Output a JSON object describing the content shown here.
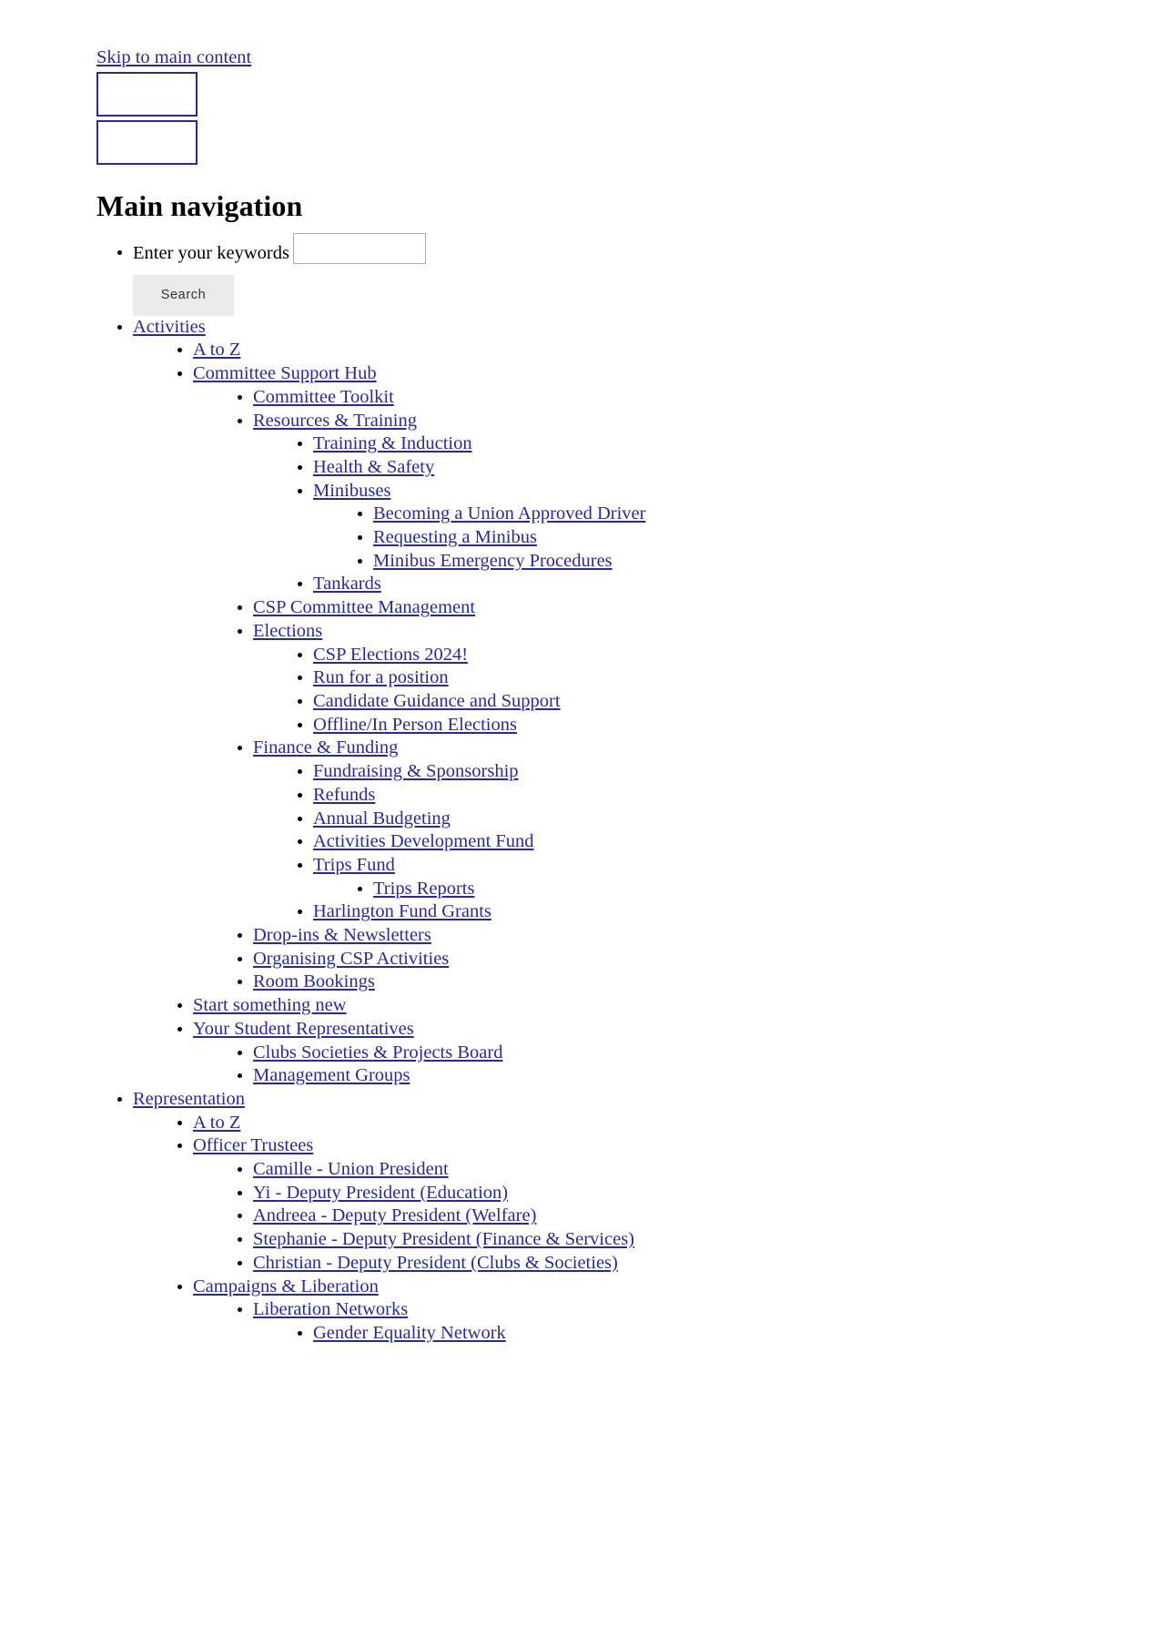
{
  "skip": {
    "label": "Skip to main content"
  },
  "branding": {
    "images": [
      {
        "name": "site-logo-primary",
        "caption": ""
      },
      {
        "name": "site-logo-secondary",
        "caption": ""
      }
    ]
  },
  "heading": {
    "title": "Main navigation"
  },
  "search": {
    "label": "Enter your keywords",
    "value": "",
    "placeholder": "",
    "button_label": "Search"
  },
  "colors": {
    "link": "#2b2b8f",
    "text": "#000000",
    "button_bg": "#ebebeb",
    "input_border": "#a9a9a9",
    "page_bg": "#ffffff"
  },
  "nav": [
    {
      "label": "Activities",
      "children": [
        {
          "label": "A to Z"
        },
        {
          "label": "Committee Support Hub",
          "children": [
            {
              "label": "Committee Toolkit"
            },
            {
              "label": "Resources & Training",
              "children": [
                {
                  "label": "Training & Induction"
                },
                {
                  "label": "Health & Safety"
                },
                {
                  "label": "Minibuses",
                  "children": [
                    {
                      "label": "Becoming a Union Approved Driver"
                    },
                    {
                      "label": "Requesting a Minibus"
                    },
                    {
                      "label": "Minibus Emergency Procedures"
                    }
                  ]
                },
                {
                  "label": "Tankards"
                }
              ]
            },
            {
              "label": "CSP Committee Management"
            },
            {
              "label": "Elections",
              "children": [
                {
                  "label": "CSP Elections 2024!"
                },
                {
                  "label": "Run for a position"
                },
                {
                  "label": "Candidate Guidance and Support"
                },
                {
                  "label": "Offline/In Person Elections"
                }
              ]
            },
            {
              "label": "Finance & Funding",
              "children": [
                {
                  "label": "Fundraising & Sponsorship"
                },
                {
                  "label": "Refunds"
                },
                {
                  "label": "Annual Budgeting"
                },
                {
                  "label": "Activities Development Fund"
                },
                {
                  "label": "Trips Fund",
                  "children": [
                    {
                      "label": "Trips Reports"
                    }
                  ]
                },
                {
                  "label": "Harlington Fund Grants"
                }
              ]
            },
            {
              "label": "Drop-ins & Newsletters"
            },
            {
              "label": "Organising CSP Activities"
            },
            {
              "label": "Room Bookings"
            }
          ]
        },
        {
          "label": "Start something new"
        },
        {
          "label": "Your Student Representatives",
          "children": [
            {
              "label": "Clubs Societies & Projects Board"
            },
            {
              "label": "Management Groups"
            }
          ]
        }
      ]
    },
    {
      "label": "Representation",
      "children": [
        {
          "label": "A to Z"
        },
        {
          "label": "Officer Trustees",
          "children": [
            {
              "label": "Camille - Union President"
            },
            {
              "label": "Yi - Deputy President (Education)"
            },
            {
              "label": "Andreea - Deputy President (Welfare)"
            },
            {
              "label": "Stephanie - Deputy President (Finance & Services)"
            },
            {
              "label": "Christian - Deputy President (Clubs & Societies)"
            }
          ]
        },
        {
          "label": "Campaigns & Liberation",
          "children": [
            {
              "label": "Liberation Networks",
              "children": [
                {
                  "label": "Gender Equality Network"
                }
              ]
            }
          ]
        }
      ]
    }
  ]
}
